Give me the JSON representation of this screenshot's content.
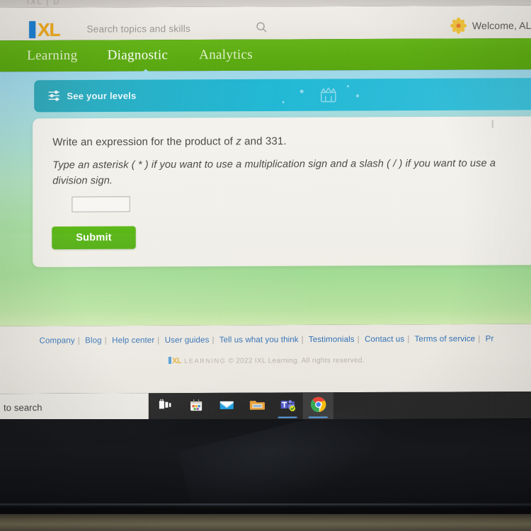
{
  "browser": {
    "ghost_tab_text": "IXL | D"
  },
  "header": {
    "logo": {
      "letter_block": "I",
      "wordmark": "XL"
    },
    "search": {
      "placeholder": "Search topics and skills",
      "value": "",
      "icon": "search-icon"
    },
    "account": {
      "avatar_icon": "flower-icon",
      "welcome_text": "Welcome, ALY"
    }
  },
  "nav": {
    "items": [
      {
        "label": "Learning",
        "active": false
      },
      {
        "label": "Diagnostic",
        "active": true
      },
      {
        "label": "Analytics",
        "active": false
      }
    ]
  },
  "banner": {
    "label": "See your levels",
    "left_icon": "sliders-icon",
    "decoration_icon": "crown-icon"
  },
  "question": {
    "prompt_prefix": "Write an expression for the product of ",
    "prompt_variable": "z",
    "prompt_suffix": " and 331.",
    "instructions": "Type an asterisk ( * ) if you want to use a multiplication sign and a slash ( / ) if you want to use a division sign.",
    "answer_value": "",
    "answer_placeholder": "",
    "submit_label": "Submit"
  },
  "footer": {
    "links": [
      "Company",
      "Blog",
      "Help center",
      "User guides",
      "Tell us what you think",
      "Testimonials",
      "Contact us",
      "Terms of service",
      "Pr"
    ],
    "separator": "|",
    "logo_letter": "I",
    "logo_wordmark": "XL",
    "logo_learning": "LEARNING",
    "copyright": "© 2022 IXL Learning. All rights reserved."
  },
  "taskbar": {
    "search_text": "to search",
    "items": [
      {
        "name": "task-view-icon",
        "active": false
      },
      {
        "name": "store-icon",
        "active": false
      },
      {
        "name": "mail-icon",
        "active": false
      },
      {
        "name": "file-explorer-icon",
        "active": false
      },
      {
        "name": "teams-icon",
        "active": false
      },
      {
        "name": "chrome-icon",
        "active": true
      }
    ]
  },
  "colors": {
    "nav_green": "#5cad10",
    "submit_green": "#4fae0d",
    "banner_blue": "#1fb9d6",
    "link_blue": "#2f6fb5",
    "logo_blue": "#1a7fd4",
    "logo_gold": "#f0a818"
  }
}
